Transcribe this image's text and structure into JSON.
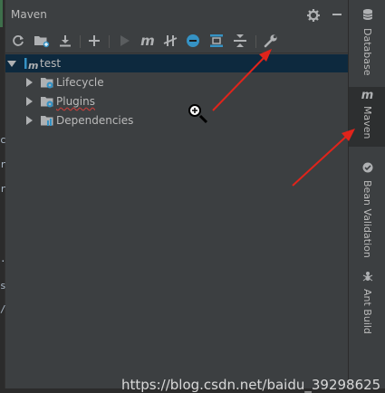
{
  "panel": {
    "title": "Maven"
  },
  "toolbar": {
    "buttons": [
      {
        "name": "reload-icon"
      },
      {
        "name": "add-folder-icon"
      },
      {
        "name": "download-icon"
      },
      {
        "name": "add-icon"
      },
      {
        "name": "run-icon"
      },
      {
        "name": "maven-goal-icon",
        "glyph": "m"
      },
      {
        "name": "toggle-offline-icon"
      },
      {
        "name": "skip-tests-icon"
      },
      {
        "name": "show-dependencies-icon"
      },
      {
        "name": "collapse-all-icon"
      },
      {
        "name": "maven-settings-wrench-icon"
      }
    ]
  },
  "tree": {
    "root": {
      "label": "test",
      "expanded": true
    },
    "children": [
      {
        "label": "Lifecycle",
        "expanded": false
      },
      {
        "label": "Plugins",
        "expanded": false
      },
      {
        "label": "Dependencies",
        "expanded": false
      }
    ]
  },
  "stripe": {
    "items": [
      {
        "label": "Database",
        "icon": "database-icon"
      },
      {
        "label": "Maven",
        "icon": "maven-icon",
        "glyph": "m",
        "active": true
      },
      {
        "label": "Bean Validation",
        "icon": "bean-validation-icon"
      },
      {
        "label": "Ant Build",
        "icon": "ant-icon"
      }
    ]
  },
  "editor": {
    "chars": [
      "c",
      "r",
      "r",
      ".",
      "s",
      "/"
    ]
  },
  "watermark": "https://blog.csdn.net/baidu_39298625",
  "colors": {
    "panel_bg": "#3c3f41",
    "selection": "#0d293e",
    "annotation_arrow": "#e0241b",
    "maven_blue": "#3592c4"
  }
}
